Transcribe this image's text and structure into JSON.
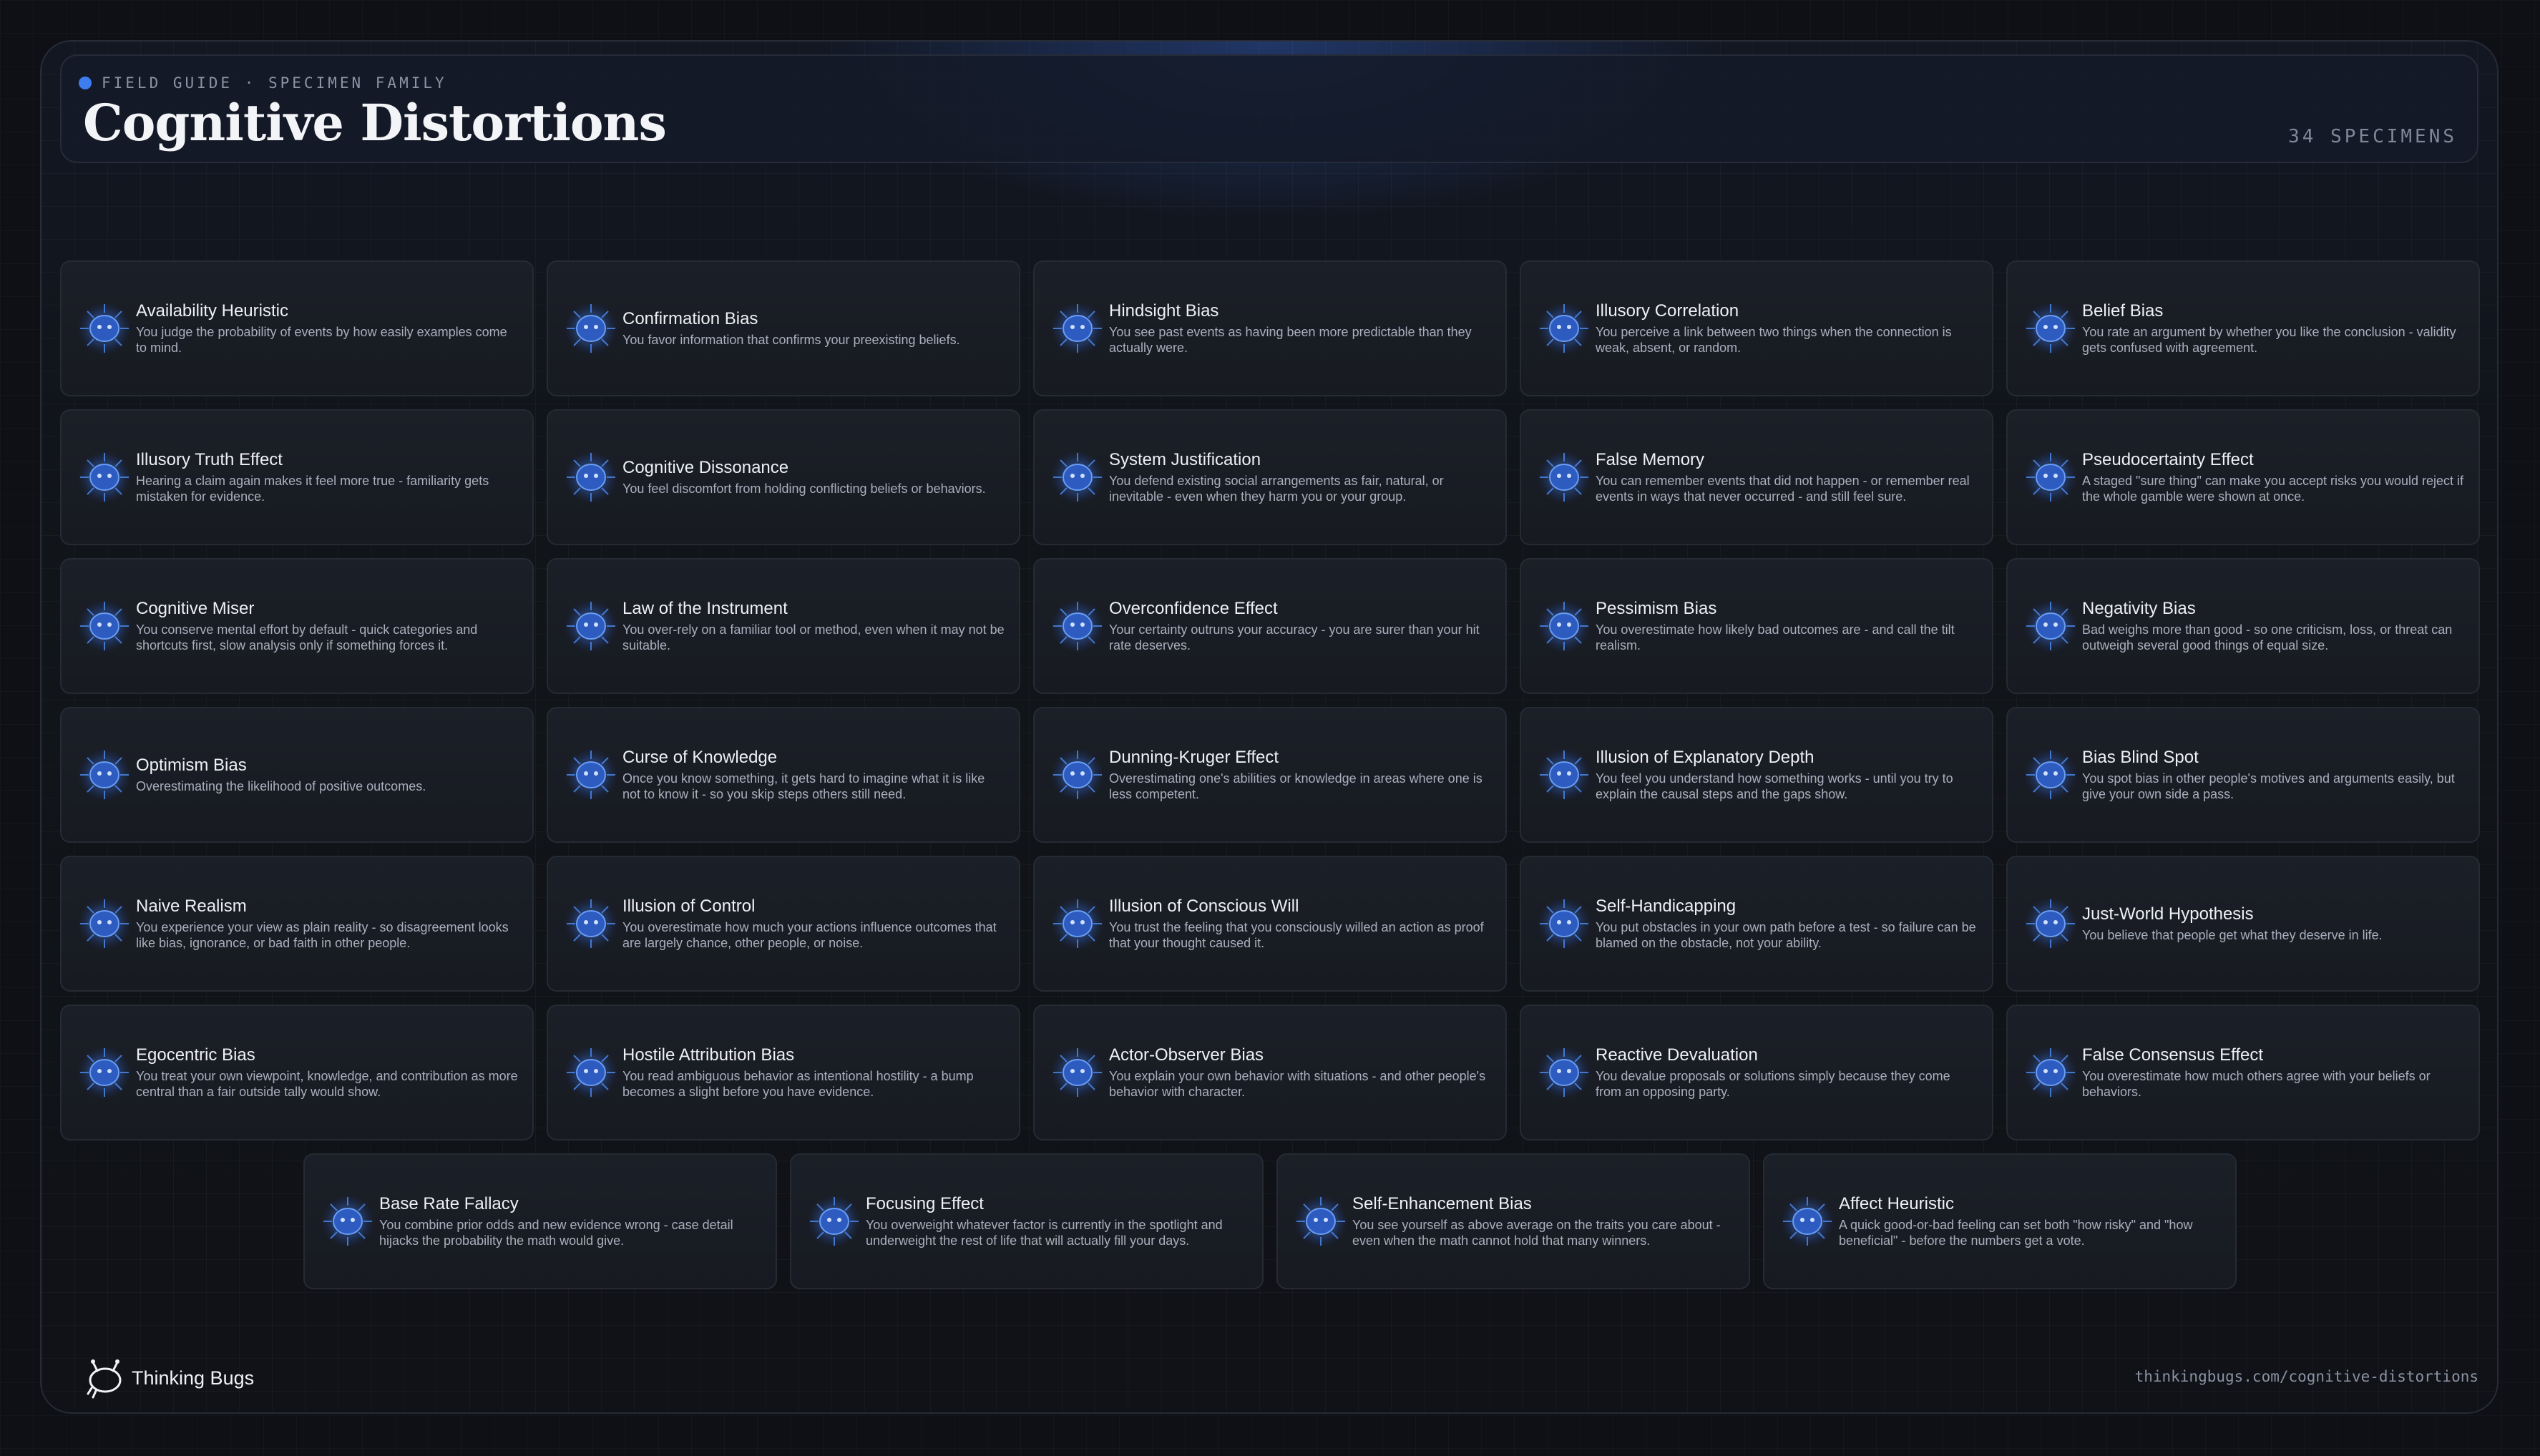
{
  "header": {
    "eyebrow": "FIELD GUIDE · SPECIMEN FAMILY",
    "title": "Cognitive Distortions",
    "count": "34 SPECIMENS"
  },
  "specimens": [
    {
      "name": "Availability Heuristic",
      "desc": "You judge the probability of events by how easily examples come to mind."
    },
    {
      "name": "Confirmation Bias",
      "desc": "You favor information that confirms your preexisting beliefs."
    },
    {
      "name": "Hindsight Bias",
      "desc": "You see past events as having been more predictable than they actually were."
    },
    {
      "name": "Illusory Correlation",
      "desc": "You perceive a link between two things when the connection is weak, absent, or random."
    },
    {
      "name": "Belief Bias",
      "desc": "You rate an argument by whether you like the conclusion - validity gets confused with agreement."
    },
    {
      "name": "Illusory Truth Effect",
      "desc": "Hearing a claim again makes it feel more true - familiarity gets mistaken for evidence."
    },
    {
      "name": "Cognitive Dissonance",
      "desc": "You feel discomfort from holding conflicting beliefs or behaviors."
    },
    {
      "name": "System Justification",
      "desc": "You defend existing social arrangements as fair, natural, or inevitable - even when they harm you or your group."
    },
    {
      "name": "False Memory",
      "desc": "You can remember events that did not happen - or remember real events in ways that never occurred - and still feel sure."
    },
    {
      "name": "Pseudocertainty Effect",
      "desc": "A staged \"sure thing\" can make you accept risks you would reject if the whole gamble were shown at once."
    },
    {
      "name": "Cognitive Miser",
      "desc": "You conserve mental effort by default - quick categories and shortcuts first, slow analysis only if something forces it."
    },
    {
      "name": "Law of the Instrument",
      "desc": "You over-rely on a familiar tool or method, even when it may not be suitable."
    },
    {
      "name": "Overconfidence Effect",
      "desc": "Your certainty outruns your accuracy - you are surer than your hit rate deserves."
    },
    {
      "name": "Pessimism Bias",
      "desc": "You overestimate how likely bad outcomes are - and call the tilt realism."
    },
    {
      "name": "Negativity Bias",
      "desc": "Bad weighs more than good - so one criticism, loss, or threat can outweigh several good things of equal size."
    },
    {
      "name": "Optimism Bias",
      "desc": "Overestimating the likelihood of positive outcomes."
    },
    {
      "name": "Curse of Knowledge",
      "desc": "Once you know something, it gets hard to imagine what it is like not to know it - so you skip steps others still need."
    },
    {
      "name": "Dunning-Kruger Effect",
      "desc": "Overestimating one's abilities or knowledge in areas where one is less competent."
    },
    {
      "name": "Illusion of Explanatory Depth",
      "desc": "You feel you understand how something works - until you try to explain the causal steps and the gaps show."
    },
    {
      "name": "Bias Blind Spot",
      "desc": "You spot bias in other people's motives and arguments easily, but give your own side a pass."
    },
    {
      "name": "Naive Realism",
      "desc": "You experience your view as plain reality - so disagreement looks like bias, ignorance, or bad faith in other people."
    },
    {
      "name": "Illusion of Control",
      "desc": "You overestimate how much your actions influence outcomes that are largely chance, other people, or noise."
    },
    {
      "name": "Illusion of Conscious Will",
      "desc": "You trust the feeling that you consciously willed an action as proof that your thought caused it."
    },
    {
      "name": "Self-Handicapping",
      "desc": "You put obstacles in your own path before a test - so failure can be blamed on the obstacle, not your ability."
    },
    {
      "name": "Just-World Hypothesis",
      "desc": "You believe that people get what they deserve in life."
    },
    {
      "name": "Egocentric Bias",
      "desc": "You treat your own viewpoint, knowledge, and contribution as more central than a fair outside tally would show."
    },
    {
      "name": "Hostile Attribution Bias",
      "desc": "You read ambiguous behavior as intentional hostility - a bump becomes a slight before you have evidence."
    },
    {
      "name": "Actor-Observer Bias",
      "desc": "You explain your own behavior with situations - and other people's behavior with character."
    },
    {
      "name": "Reactive Devaluation",
      "desc": "You devalue proposals or solutions simply because they come from an opposing party."
    },
    {
      "name": "False Consensus Effect",
      "desc": "You overestimate how much others agree with your beliefs or behaviors."
    },
    {
      "name": "Base Rate Fallacy",
      "desc": "You combine prior odds and new evidence wrong - case detail hijacks the probability the math would give."
    },
    {
      "name": "Focusing Effect",
      "desc": "You overweight whatever factor is currently in the spotlight and underweight the rest of life that will actually fill your days."
    },
    {
      "name": "Self-Enhancement Bias",
      "desc": "You see yourself as above average on the traits you care about - even when the math cannot hold that many winners."
    },
    {
      "name": "Affect Heuristic",
      "desc": "A quick good-or-bad feeling can set both \"how risky\" and \"how beneficial\" - before the numbers get a vote."
    }
  ],
  "footer": {
    "brand": "Thinking Bugs",
    "url": "thinkingbugs.com/cognitive-distortions"
  },
  "icons": {
    "specimen": "bug-specimen-icon",
    "logo": "thinking-bug-logo-icon"
  },
  "colors": {
    "accent": "#3d7df0",
    "icon_glow": "#4a86e8"
  }
}
